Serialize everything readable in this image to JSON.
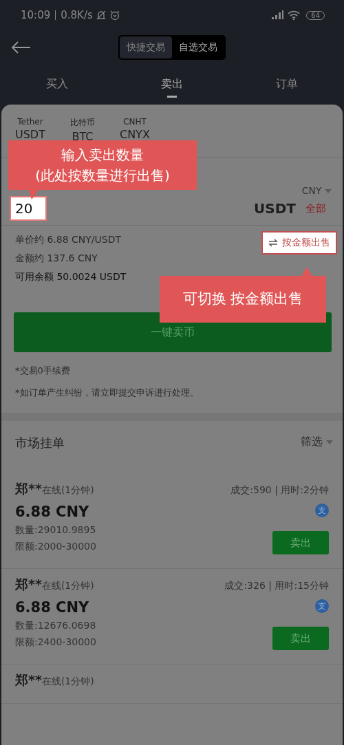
{
  "status_bar": {
    "time": "10:09",
    "speed": "0.8K/s",
    "battery": "64"
  },
  "mode_switch": [
    {
      "label": "快捷交易",
      "selected": true
    },
    {
      "label": "自选交易",
      "selected": false
    }
  ],
  "tabs": [
    {
      "label": "买入",
      "selected": false
    },
    {
      "label": "卖出",
      "selected": true
    },
    {
      "label": "订单",
      "selected": false
    }
  ],
  "coins": [
    {
      "name": "Tether",
      "symbol": "USDT"
    },
    {
      "name": "比特币",
      "symbol": "BTC"
    },
    {
      "name": "CNHT",
      "symbol": "CNYX"
    }
  ],
  "form": {
    "currency": "CNY",
    "value": "20",
    "unit": "USDT",
    "all_link": "全部",
    "unit_price": "单价约 6.88 CNY/USDT",
    "total": "金额约 137.6 CNY",
    "balance": "可用余额 50.0024 USDT",
    "switch_link": "按金额出售",
    "submit": "一键卖币"
  },
  "notes": [
    "*交易0手续费",
    "*如订单产生纠纷，请立即提交申诉进行处理。"
  ],
  "market": {
    "title": "市场挂单",
    "filter": "筛选",
    "rows": [
      {
        "kind": "full",
        "name": "郑**",
        "status": "在线(1分钟)",
        "stats": "成交:590 | 用时:2分钟",
        "price": "6.88 CNY",
        "quantity": "数量:29010.9895",
        "limit": "限额:2000-30000",
        "pay_badge": "支",
        "action": "卖出"
      },
      {
        "kind": "full",
        "name": "郑**",
        "status": "在线(1分钟)",
        "stats": "成交:326 | 用时:15分钟",
        "price": "6.88 CNY",
        "quantity": "数量:12676.0698",
        "limit": "限额:2400-30000",
        "pay_badge": "支",
        "action": "卖出"
      },
      {
        "kind": "partial",
        "name": "郑**",
        "status": "在线(1分钟)"
      }
    ]
  },
  "callouts": [
    {
      "kind": "amount",
      "lines": [
        "输入卖出数量",
        "(此处按数量进行出售)"
      ]
    },
    {
      "kind": "switch",
      "lines": [
        "可切换 按金额出售"
      ]
    }
  ]
}
